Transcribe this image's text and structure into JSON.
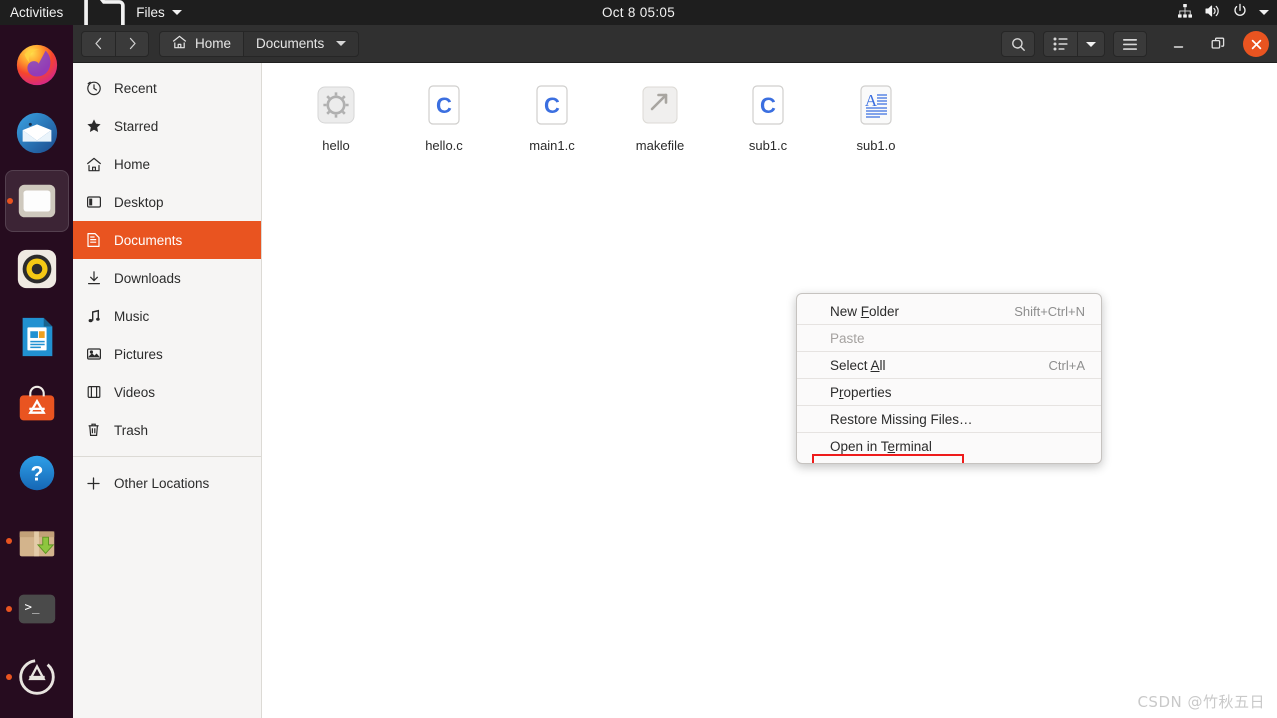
{
  "topbar": {
    "activities": "Activities",
    "app_name": "Files",
    "app_icon": "folder-icon",
    "app_caret": "chevron-down-icon",
    "clock": "Oct 8  05:05",
    "indicators": [
      "network-icon",
      "volume-icon",
      "power-icon",
      "chevron-down-icon"
    ]
  },
  "dock": {
    "items": [
      {
        "name": "firefox",
        "label": "Firefox",
        "running": false,
        "active": false
      },
      {
        "name": "thunderbird",
        "label": "Thunderbird",
        "running": false,
        "active": false
      },
      {
        "name": "files",
        "label": "Files",
        "running": true,
        "active": true
      },
      {
        "name": "rhythmbox",
        "label": "Rhythmbox",
        "running": false,
        "active": false
      },
      {
        "name": "libreoffice-writer",
        "label": "LibreOffice Writer",
        "running": false,
        "active": false
      },
      {
        "name": "ubuntu-software",
        "label": "Ubuntu Software",
        "running": false,
        "active": false
      },
      {
        "name": "help",
        "label": "Help",
        "running": false,
        "active": false
      },
      {
        "name": "package-installer",
        "label": "Package Installer",
        "running": true,
        "active": false
      },
      {
        "name": "terminal",
        "label": "Terminal",
        "running": true,
        "active": false
      },
      {
        "name": "software-updater",
        "label": "Software Updater",
        "running": true,
        "active": false
      }
    ]
  },
  "headerbar": {
    "back_icon": "chevron-left-icon",
    "forward_icon": "chevron-right-icon",
    "path": [
      {
        "label": "Home",
        "icon": "home-icon",
        "active": false
      },
      {
        "label": "Documents",
        "icon": "",
        "active": true
      }
    ],
    "search_icon": "search-icon",
    "view_icon": "list-view-icon",
    "view_caret": "chevron-down-icon",
    "menu_icon": "hamburger-menu-icon",
    "minimize_icon": "minimize-icon",
    "maximize_icon": "maximize-icon",
    "close_icon": "close-icon"
  },
  "sidebar": {
    "items": [
      {
        "label": "Recent",
        "icon": "clock-icon",
        "selected": false
      },
      {
        "label": "Starred",
        "icon": "star-icon",
        "selected": false
      },
      {
        "label": "Home",
        "icon": "home-icon",
        "selected": false
      },
      {
        "label": "Desktop",
        "icon": "desktop-icon",
        "selected": false
      },
      {
        "label": "Documents",
        "icon": "document-icon",
        "selected": true
      },
      {
        "label": "Downloads",
        "icon": "download-icon",
        "selected": false
      },
      {
        "label": "Music",
        "icon": "music-icon",
        "selected": false
      },
      {
        "label": "Pictures",
        "icon": "picture-icon",
        "selected": false
      },
      {
        "label": "Videos",
        "icon": "video-icon",
        "selected": false
      },
      {
        "label": "Trash",
        "icon": "trash-icon",
        "selected": false
      }
    ],
    "other_locations": {
      "label": "Other Locations",
      "icon": "plus-icon"
    }
  },
  "files": [
    {
      "name": "hello",
      "icon": "executable-icon"
    },
    {
      "name": "hello.c",
      "icon": "c-source-icon"
    },
    {
      "name": "main1.c",
      "icon": "c-source-icon"
    },
    {
      "name": "makefile",
      "icon": "makefile-icon"
    },
    {
      "name": "sub1.c",
      "icon": "c-source-icon"
    },
    {
      "name": "sub1.o",
      "icon": "text-document-icon"
    }
  ],
  "context_menu": {
    "items": [
      {
        "label": "New Folder",
        "mnemonic": "F",
        "accel": "Shift+Ctrl+N",
        "disabled": false,
        "highlighted": false
      },
      {
        "label": "Paste",
        "mnemonic": "",
        "accel": "",
        "disabled": true,
        "highlighted": false
      },
      {
        "label": "Select All",
        "mnemonic": "A",
        "accel": "Ctrl+A",
        "disabled": false,
        "highlighted": false
      },
      {
        "label": "Properties",
        "mnemonic": "r",
        "accel": "",
        "disabled": false,
        "highlighted": false
      },
      {
        "label": "Restore Missing Files…",
        "mnemonic": "",
        "accel": "",
        "disabled": false,
        "highlighted": false
      },
      {
        "label": "Open in Terminal",
        "mnemonic": "e",
        "accel": "",
        "disabled": false,
        "highlighted": true
      }
    ],
    "highlight_color": "#ee1b1b"
  },
  "watermark": "CSDN @竹秋五日",
  "colors": {
    "accent": "#e95420",
    "topbar_bg": "#1e1e1e",
    "headerbar_bg": "#303030",
    "sidebar_bg": "#f6f5f4",
    "main_bg": "#ffffff",
    "dock_bg": "#260c1f"
  }
}
